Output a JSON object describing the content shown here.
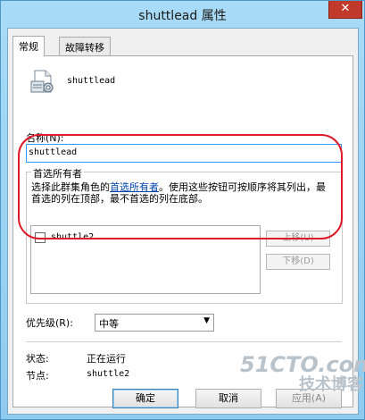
{
  "window": {
    "title": "shuttlead 属性",
    "close_glyph": "✕"
  },
  "tabs": [
    {
      "label": "常规",
      "active": true
    },
    {
      "label": "故障转移",
      "active": false
    }
  ],
  "resource": {
    "icon": "cluster-role-icon",
    "name": "shuttlead"
  },
  "name_field": {
    "label": "名称(N):",
    "value": "shuttlead"
  },
  "preferred_owners": {
    "title": "首选所有者",
    "description_before": "选择此群集角色的",
    "description_link": "首选所有者",
    "description_after": "。使用这些按钮可按顺序将其列出，最首选的列在顶部，最不首选的列在底部。",
    "items": [
      {
        "label": "shuttle2",
        "checked": false
      }
    ],
    "move_up": "上移(U)",
    "move_down": "下移(D)"
  },
  "priority": {
    "label": "优先级(R):",
    "value": "中等"
  },
  "status": {
    "label": "状态:",
    "value": "正在运行"
  },
  "node": {
    "label": "节点:",
    "value": "shuttle2"
  },
  "buttons": {
    "ok": "确定",
    "cancel": "取消",
    "apply": "应用(A)"
  },
  "watermark": {
    "line1": "51CTO.com",
    "line2": "技术博客"
  },
  "colors": {
    "highlight": "#e0192a",
    "link": "#0044aa",
    "title_bar": "#a8dbf7",
    "close_button": "#c0392b"
  }
}
